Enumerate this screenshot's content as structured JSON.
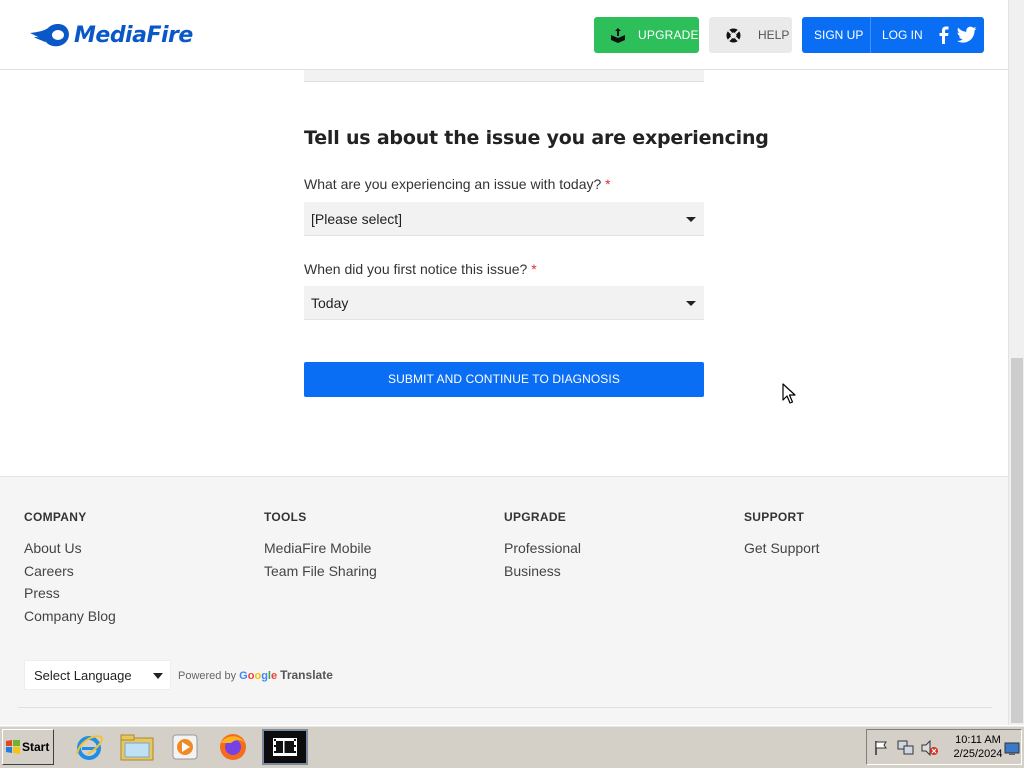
{
  "header": {
    "logo_text": "MediaFire",
    "upgrade_label": "UPGRADE",
    "help_label": "HELP",
    "signup_label": "SIGN UP",
    "login_label": "LOG IN"
  },
  "form": {
    "title": "Tell us about the issue you are experiencing",
    "question1": "What are you experiencing an issue with today?",
    "question1_value": "[Please select]",
    "question2": "When did you first notice this issue?",
    "question2_value": "Today",
    "required_mark": "*",
    "submit_label": "SUBMIT AND CONTINUE TO DIAGNOSIS"
  },
  "footer": {
    "columns": [
      {
        "heading": "COMPANY",
        "links": [
          "About Us",
          "Careers",
          "Press",
          "Company Blog"
        ]
      },
      {
        "heading": "TOOLS",
        "links": [
          "MediaFire Mobile",
          "Team File Sharing"
        ]
      },
      {
        "heading": "UPGRADE",
        "links": [
          "Professional",
          "Business"
        ]
      },
      {
        "heading": "SUPPORT",
        "links": [
          "Get Support"
        ]
      }
    ],
    "language_select": "Select Language",
    "powered_by": "Powered by",
    "google": "Google",
    "translate": "Translate"
  },
  "taskbar": {
    "start_label": "Start",
    "time": "10:11 AM",
    "date": "2/25/2024",
    "apps": [
      "internet-explorer-icon",
      "file-explorer-icon",
      "media-player-icon",
      "firefox-icon",
      "video-app-icon"
    ]
  },
  "colors": {
    "brand_blue": "#0a6ef5",
    "upgrade_green": "#2dbf5a",
    "required_red": "#d9302f"
  }
}
